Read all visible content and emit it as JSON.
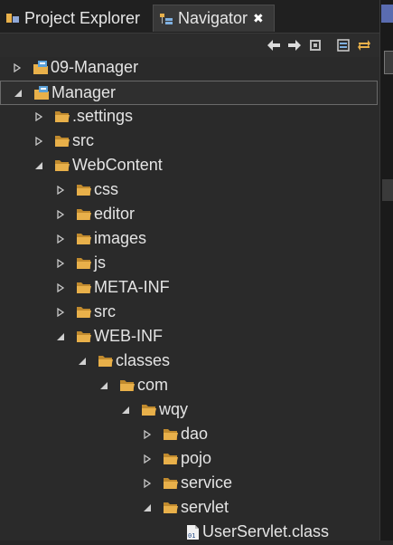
{
  "tabs": [
    {
      "label": "Project Explorer",
      "active": false
    },
    {
      "label": "Navigator",
      "active": true,
      "close": "✖"
    }
  ],
  "toolbar": [
    "back-icon",
    "forward-icon",
    "go-into-icon",
    "collapse-all-icon",
    "link-with-editor-icon"
  ],
  "tree": [
    {
      "label": "09-Manager",
      "depth": 0,
      "expanded": false,
      "type": "project"
    },
    {
      "label": "Manager",
      "depth": 0,
      "expanded": true,
      "type": "project",
      "selected": true
    },
    {
      "label": ".settings",
      "depth": 1,
      "expanded": false,
      "type": "folder"
    },
    {
      "label": "src",
      "depth": 1,
      "expanded": false,
      "type": "folder"
    },
    {
      "label": "WebContent",
      "depth": 1,
      "expanded": true,
      "type": "folder"
    },
    {
      "label": "css",
      "depth": 2,
      "expanded": false,
      "type": "folder"
    },
    {
      "label": "editor",
      "depth": 2,
      "expanded": false,
      "type": "folder"
    },
    {
      "label": "images",
      "depth": 2,
      "expanded": false,
      "type": "folder"
    },
    {
      "label": "js",
      "depth": 2,
      "expanded": false,
      "type": "folder"
    },
    {
      "label": "META-INF",
      "depth": 2,
      "expanded": false,
      "type": "folder"
    },
    {
      "label": "src",
      "depth": 2,
      "expanded": false,
      "type": "folder"
    },
    {
      "label": "WEB-INF",
      "depth": 2,
      "expanded": true,
      "type": "folder"
    },
    {
      "label": "classes",
      "depth": 3,
      "expanded": true,
      "type": "folder"
    },
    {
      "label": "com",
      "depth": 4,
      "expanded": true,
      "type": "folder"
    },
    {
      "label": "wqy",
      "depth": 5,
      "expanded": true,
      "type": "folder"
    },
    {
      "label": "dao",
      "depth": 6,
      "expanded": false,
      "type": "folder"
    },
    {
      "label": "pojo",
      "depth": 6,
      "expanded": false,
      "type": "folder"
    },
    {
      "label": "service",
      "depth": 6,
      "expanded": false,
      "type": "folder"
    },
    {
      "label": "servlet",
      "depth": 6,
      "expanded": true,
      "type": "folder"
    },
    {
      "label": "UserServlet.class",
      "depth": 7,
      "type": "class-file"
    }
  ],
  "colors": {
    "folder": "#e8b04a",
    "background": "#2a2a2a",
    "text": "#e4e4e4",
    "selection_border": "#6a6a6a"
  }
}
